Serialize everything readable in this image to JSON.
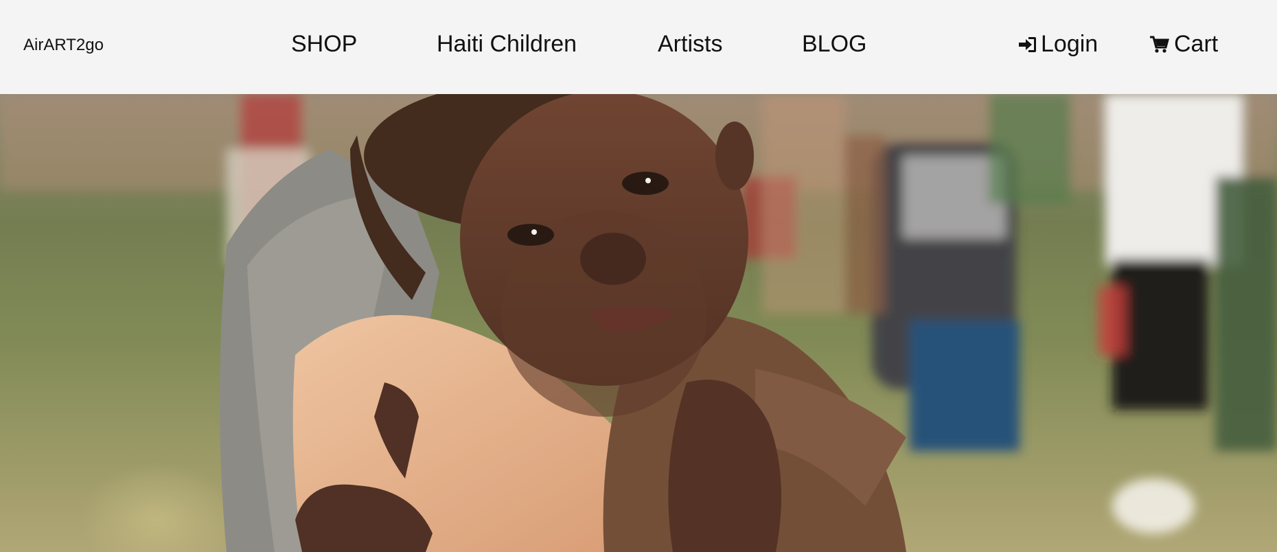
{
  "header": {
    "logo": "AirART2go",
    "nav": [
      "SHOP",
      "Haiti Children",
      "Artists",
      "BLOG"
    ],
    "login_label": "Login",
    "cart_label": "Cart",
    "icons": {
      "login": "sign-in-icon",
      "cart": "shopping-cart-icon"
    }
  },
  "hero": {
    "image": "photo-child-held-by-adult"
  },
  "colors": {
    "header_bg": "#f4f4f4",
    "text": "#111111"
  }
}
